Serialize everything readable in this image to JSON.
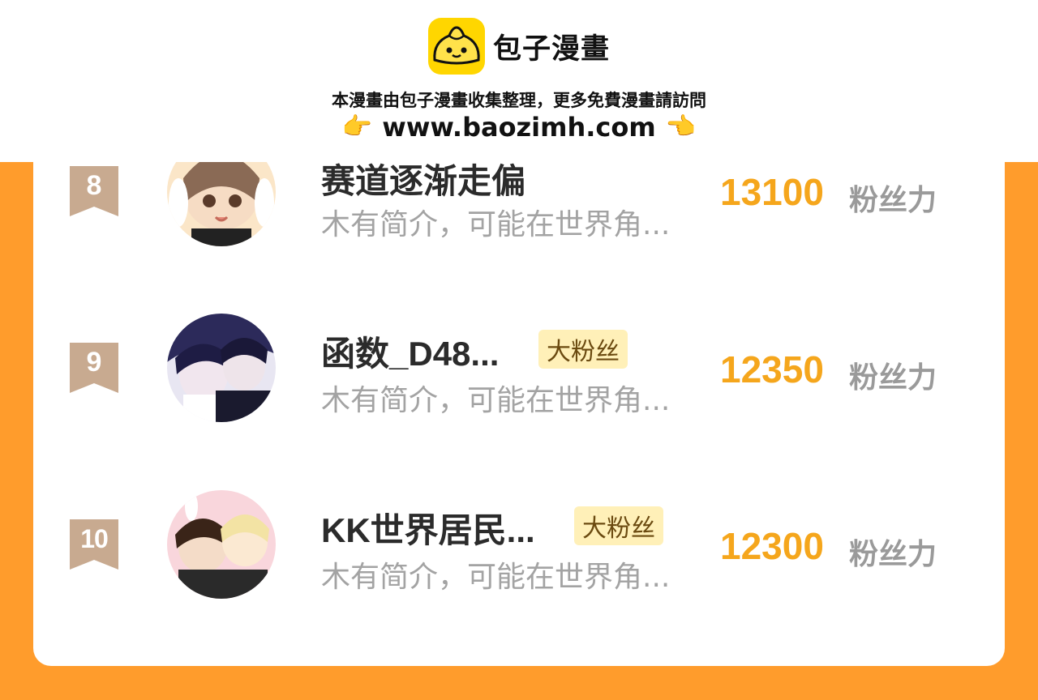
{
  "header": {
    "logo_text": "包子漫畫",
    "notice": "本漫畫由包子漫畫收集整理，更多免費漫畫請訪問",
    "url": "www.baozimh.com",
    "left_hand_icon": "pointing-right-hand-icon",
    "right_hand_icon": "pointing-left-hand-icon"
  },
  "colors": {
    "frame": "#FF9C2C",
    "score": "#F5A61C",
    "badge_bg": "#FFF0B8",
    "rank_ribbon": "#C8AA90",
    "logo_bg": "#FFD600"
  },
  "rows": [
    {
      "rank": "8",
      "name": "赛道逐渐走偏",
      "badge": "",
      "desc": "木有简介，可能在世界角...",
      "score": "13100",
      "score_unit": "粉丝力"
    },
    {
      "rank": "9",
      "name": "函数_D48...",
      "badge": "大粉丝",
      "desc": "木有简介，可能在世界角...",
      "score": "12350",
      "score_unit": "粉丝力"
    },
    {
      "rank": "10",
      "name": "KK世界居民...",
      "badge": "大粉丝",
      "desc": "木有简介，可能在世界角...",
      "score": "12300",
      "score_unit": "粉丝力"
    }
  ]
}
